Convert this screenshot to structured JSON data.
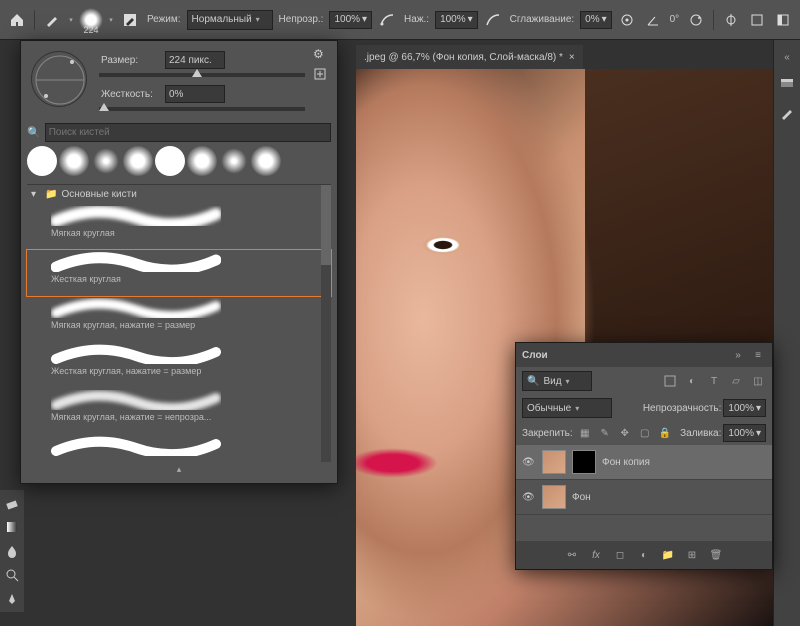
{
  "topbar": {
    "brush_size_display": "224",
    "mode_label": "Режим:",
    "mode_value": "Нормальный",
    "opacity_label": "Непрозр.:",
    "opacity_value": "100%",
    "flow_label": "Наж.:",
    "flow_value": "100%",
    "smoothing_label": "Сглаживание:",
    "smoothing_value": "0%",
    "angle_label": "0°"
  },
  "brush_panel": {
    "size_label": "Размер:",
    "size_value": "224 пикс.",
    "hardness_label": "Жесткость:",
    "hardness_value": "0%",
    "search_placeholder": "Поиск кистей",
    "group_name": "Основные кисти",
    "brushes": [
      {
        "label": "Мягкая круглая"
      },
      {
        "label": "Жесткая круглая"
      },
      {
        "label": "Мягкая круглая, нажатие = размер"
      },
      {
        "label": "Жесткая круглая, нажатие = размер"
      },
      {
        "label": "Мягкая круглая, нажатие = непрозра..."
      }
    ]
  },
  "tab": {
    "title": ".jpeg @ 66,7% (Фон копия, Слой-маска/8) *"
  },
  "layers": {
    "title": "Слои",
    "kind_label": "Вид",
    "blend_label": "Обычные",
    "opacity_label": "Непрозрачность:",
    "opacity_value": "100%",
    "lock_label": "Закрепить:",
    "fill_label": "Заливка:",
    "fill_value": "100%",
    "items": [
      {
        "name": "Фон копия"
      },
      {
        "name": "Фон"
      }
    ]
  },
  "right_rail": {
    "items": [
      "histogram",
      "swatches",
      "brush",
      "more"
    ]
  }
}
